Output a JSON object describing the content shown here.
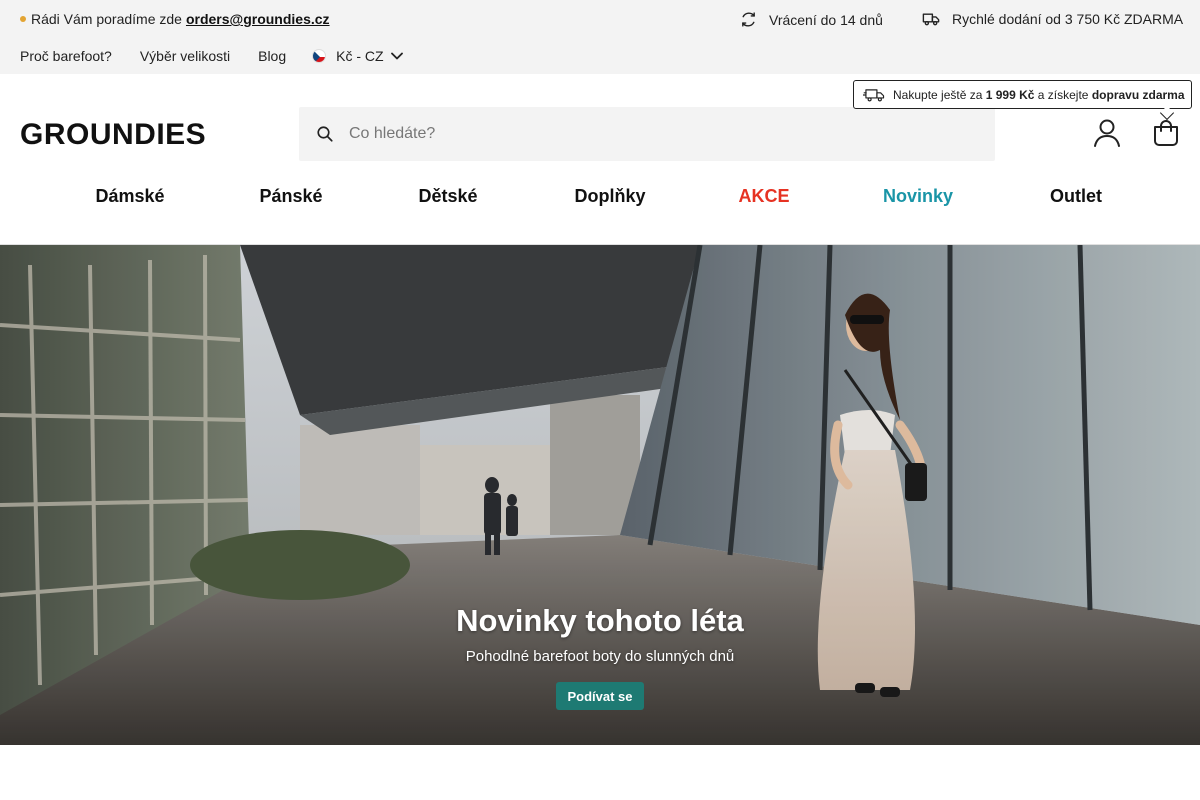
{
  "topbar": {
    "contact_text": "Rádi Vám poradíme zde",
    "contact_email": "orders@groundies.cz",
    "returns": "Vrácení do 14 dnů",
    "delivery": "Rychlé dodání od 3 750 Kč ZDARMA",
    "links": [
      "Proč barefoot?",
      "Výběr velikosti",
      "Blog"
    ],
    "currency": "Kč - CZ"
  },
  "header": {
    "logo": "GROUNDIES",
    "search_placeholder": "Co hledáte?",
    "promo": {
      "prefix": "Nakupte ještě za",
      "amount": "1 999 Kč",
      "middle": "a získejte",
      "highlight": "dopravu zdarma"
    }
  },
  "nav": {
    "items": [
      "Dámské",
      "Pánské",
      "Dětské",
      "Doplňky",
      "AKCE",
      "Novinky",
      "Outlet"
    ]
  },
  "hero": {
    "title": "Novinky tohoto léta",
    "subtitle": "Pohodlné barefoot boty do slunných dnů",
    "cta": "Podívat se"
  },
  "colors": {
    "accent": "#1e7a73",
    "sale": "#e63222",
    "new": "#1a95a7",
    "contact_dot": "#e3a432"
  }
}
